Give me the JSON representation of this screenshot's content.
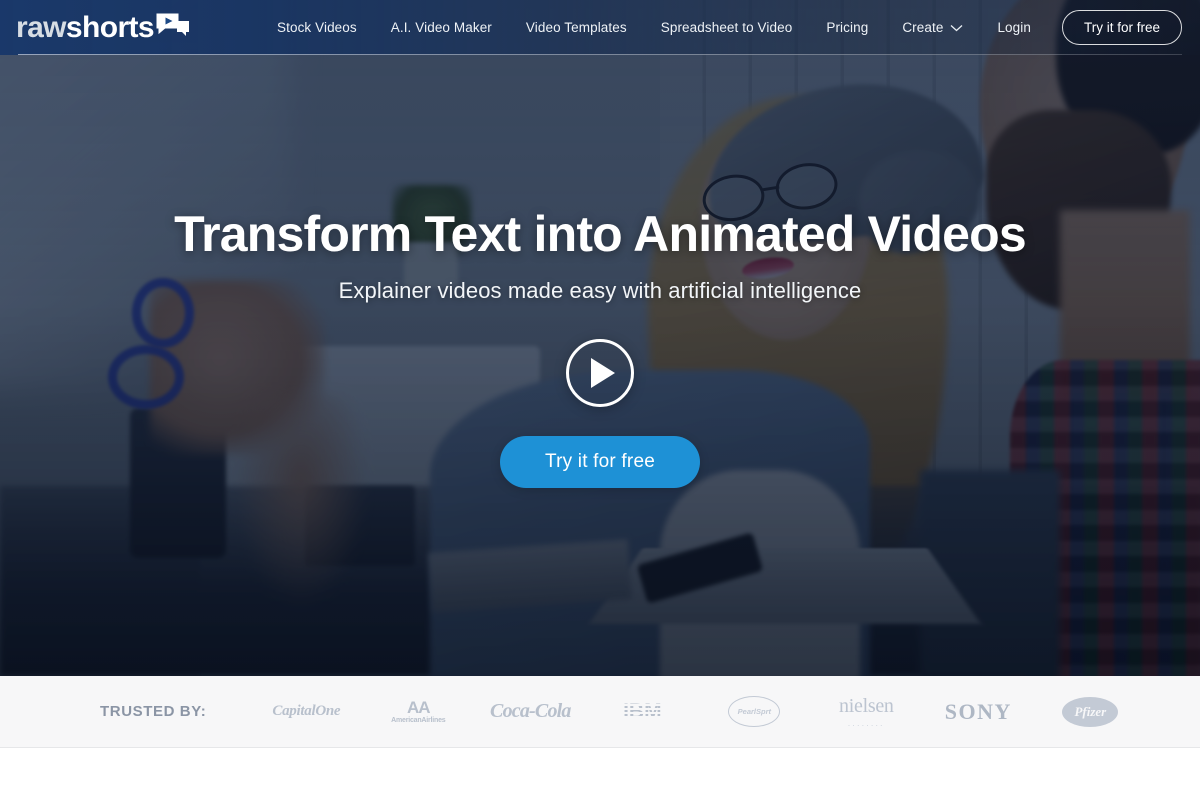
{
  "brand": {
    "name_part1": "raw",
    "name_part2": "shorts",
    "logo_icon": "video-chat-bubble-icon"
  },
  "nav": {
    "items": [
      {
        "label": "Stock Videos",
        "name": "nav-stock-videos"
      },
      {
        "label": "A.I. Video Maker",
        "name": "nav-ai-video-maker"
      },
      {
        "label": "Video Templates",
        "name": "nav-video-templates"
      },
      {
        "label": "Spreadsheet to Video",
        "name": "nav-spreadsheet-to-video"
      },
      {
        "label": "Pricing",
        "name": "nav-pricing"
      },
      {
        "label": "Create",
        "name": "nav-create",
        "has_caret": true
      },
      {
        "label": "Login",
        "name": "nav-login"
      }
    ],
    "cta_label": "Try it for free"
  },
  "hero": {
    "title": "Transform Text into Animated Videos",
    "subtitle": "Explainer videos made easy with artificial intelligence",
    "play_label": "play-video",
    "cta_label": "Try it for free"
  },
  "trusted": {
    "label": "TRUSTED BY:",
    "logos": [
      {
        "name": "logo-capital-one",
        "text": "CapitalOne"
      },
      {
        "name": "logo-american-airlines",
        "text": "AA",
        "sub": "AmericanAirlines"
      },
      {
        "name": "logo-coca-cola",
        "text": "Coca-Cola"
      },
      {
        "name": "logo-ibm",
        "text": "IBM"
      },
      {
        "name": "logo-oval-badge",
        "text": "PearlSprt"
      },
      {
        "name": "logo-nielsen",
        "text": "nielsen",
        "sub": "........"
      },
      {
        "name": "logo-sony",
        "text": "SONY"
      },
      {
        "name": "logo-pfizer",
        "text": "Pfizer"
      }
    ]
  },
  "colors": {
    "header_blue": "#19386a",
    "cta_blue": "#1e91d6",
    "trusted_bg": "#f7f7f8",
    "logo_gray": "#b8c0cc"
  }
}
